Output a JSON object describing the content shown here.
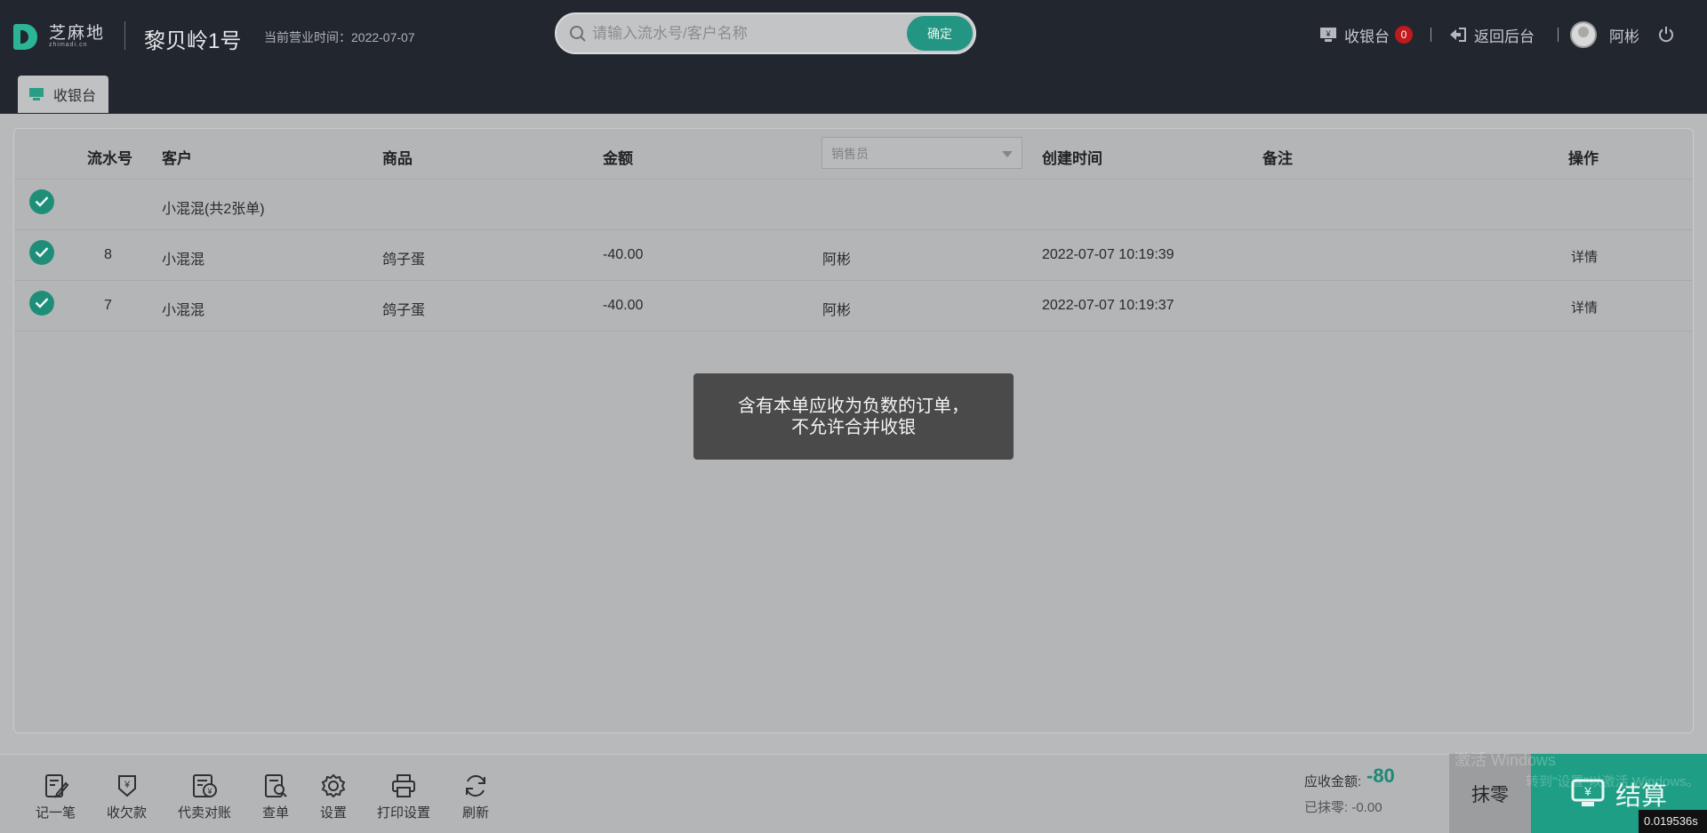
{
  "header": {
    "logo_zh": "芝麻地",
    "logo_en": "zhimadi.cn",
    "store_name": "黎贝岭1号",
    "biz_time_label": "当前营业时间：",
    "biz_time_value": "2022-07-07",
    "search": {
      "placeholder": "请输入流水号/客户名称",
      "value": "",
      "button": "确定"
    },
    "cashier_link": "收银台",
    "cashier_badge": "0",
    "back_link": "返回后台",
    "user_name": "阿彬"
  },
  "tabs": [
    {
      "label": "收银台",
      "active": true
    }
  ],
  "table": {
    "columns": {
      "serial": "流水号",
      "customer": "客户",
      "goods": "商品",
      "amount": "金额",
      "seller_placeholder": "销售员",
      "created": "创建时间",
      "remark": "备注",
      "action": "操作"
    },
    "group_row": {
      "customer": "小混混(共2张单)",
      "checked": true
    },
    "rows": [
      {
        "serial": "8",
        "customer": "小混混",
        "goods": "鸽子蛋",
        "amount": "-40.00",
        "seller": "阿彬",
        "created": "2022-07-07 10:19:39",
        "remark": "",
        "action": "详情",
        "checked": true
      },
      {
        "serial": "7",
        "customer": "小混混",
        "goods": "鸽子蛋",
        "amount": "-40.00",
        "seller": "阿彬",
        "created": "2022-07-07 10:19:37",
        "remark": "",
        "action": "详情",
        "checked": true
      }
    ]
  },
  "toast": {
    "line1": "含有本单应收为负数的订单，",
    "line2": "不允许合并收银"
  },
  "toolbar": [
    {
      "label": "记一笔",
      "icon": "note-edit-icon"
    },
    {
      "label": "收欠款",
      "icon": "receive-debt-icon"
    },
    {
      "label": "代卖对账",
      "icon": "reconcile-icon"
    },
    {
      "label": "查单",
      "icon": "search-order-icon"
    },
    {
      "label": "设置",
      "icon": "gear-icon"
    },
    {
      "label": "打印设置",
      "icon": "printer-icon"
    },
    {
      "label": "刷新",
      "icon": "refresh-icon"
    }
  ],
  "summary": {
    "receivable_label": "应收金额:",
    "receivable_value": "-80",
    "wiped_label": "已抹零:",
    "wiped_value": "-0.00"
  },
  "actions": {
    "wipe": "抹零",
    "checkout": "结算"
  },
  "watermark": {
    "line1": "激活 Windows",
    "line2": "转到\"设置\"以激活 Windows。"
  },
  "timer": "0.019536s",
  "colors": {
    "accent": "#239683",
    "header_bg": "#22262f",
    "badge": "#c0191e"
  }
}
